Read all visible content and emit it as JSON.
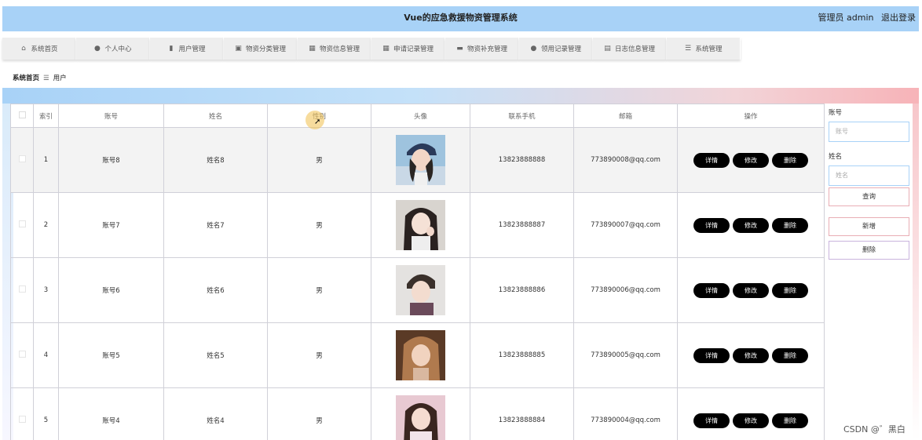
{
  "header": {
    "title": "Vue的应急救援物资管理系统",
    "user_label": "管理员 admin",
    "logout": "退出登录"
  },
  "nav": [
    {
      "label": "系统首页",
      "icon": "home-icon",
      "glyph": "⌂"
    },
    {
      "label": "个人中心",
      "icon": "user-icon",
      "glyph": "●"
    },
    {
      "label": "用户管理",
      "icon": "chart-icon",
      "glyph": "▮"
    },
    {
      "label": "物资分类管理",
      "icon": "clipboard-icon",
      "glyph": "▣"
    },
    {
      "label": "物资信息管理",
      "icon": "grid-icon",
      "glyph": "▦"
    },
    {
      "label": "申请记录管理",
      "icon": "grid-icon",
      "glyph": "▦"
    },
    {
      "label": "物资补充管理",
      "icon": "briefcase-icon",
      "glyph": "▬"
    },
    {
      "label": "领用记录管理",
      "icon": "user-icon",
      "glyph": "●"
    },
    {
      "label": "日志信息管理",
      "icon": "book-icon",
      "glyph": "▤"
    },
    {
      "label": "系统管理",
      "icon": "menu-icon",
      "glyph": "☰"
    }
  ],
  "breadcrumb": {
    "home": "系统首页",
    "separator": "☰",
    "current": "用户"
  },
  "table": {
    "headers": [
      "索引",
      "账号",
      "姓名",
      "性别",
      "头像",
      "联系手机",
      "邮箱",
      "操作"
    ],
    "rows": [
      {
        "index": "1",
        "account": "账号8",
        "name": "姓名8",
        "gender": "男",
        "phone": "13823888888",
        "email": "773890008@qq.com"
      },
      {
        "index": "2",
        "account": "账号7",
        "name": "姓名7",
        "gender": "男",
        "phone": "13823888887",
        "email": "773890007@qq.com"
      },
      {
        "index": "3",
        "account": "账号6",
        "name": "姓名6",
        "gender": "男",
        "phone": "13823888886",
        "email": "773890006@qq.com"
      },
      {
        "index": "4",
        "account": "账号5",
        "name": "姓名5",
        "gender": "男",
        "phone": "13823888885",
        "email": "773890005@qq.com"
      },
      {
        "index": "5",
        "account": "账号4",
        "name": "姓名4",
        "gender": "男",
        "phone": "13823888884",
        "email": "773890004@qq.com"
      }
    ],
    "actions": {
      "detail": "详情",
      "edit": "修改",
      "delete": "删除"
    }
  },
  "search": {
    "account_label": "账号",
    "account_placeholder": "账号",
    "name_label": "姓名",
    "name_placeholder": "姓名",
    "query": "查询",
    "add": "新增",
    "delete": "删除"
  },
  "watermark": "CSDN @゛黑白",
  "colors": {
    "header_bg": "#a8d2f7",
    "button_bg": "#000000",
    "input_border": "#a8d2f7",
    "button_border": "#e9aeb5"
  }
}
